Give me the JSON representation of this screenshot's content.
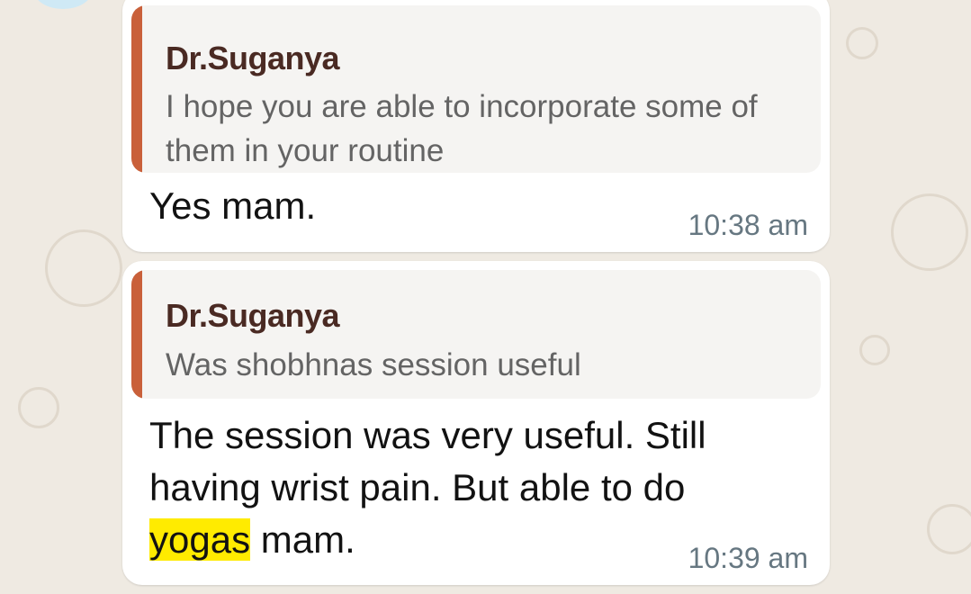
{
  "messages": [
    {
      "quote_author": "Dr.Suganya",
      "quote_text": "I hope you are able to incorporate some of them in your routine",
      "text": "Yes mam.",
      "time": "10:38 am"
    },
    {
      "quote_author": "Dr.Suganya",
      "quote_text": "Was shobhnas session useful",
      "text_before_highlight": "The session was very useful. Still having wrist pain. But able to do ",
      "highlight": "yogas",
      "text_after_highlight": " mam.",
      "time": "10:39 am"
    }
  ],
  "colors": {
    "background": "#efeae2",
    "bubble": "#ffffff",
    "quote_bar": "#c9603a",
    "quote_author": "#4a2a23",
    "highlight": "#ffeb00",
    "timestamp": "#667781"
  }
}
